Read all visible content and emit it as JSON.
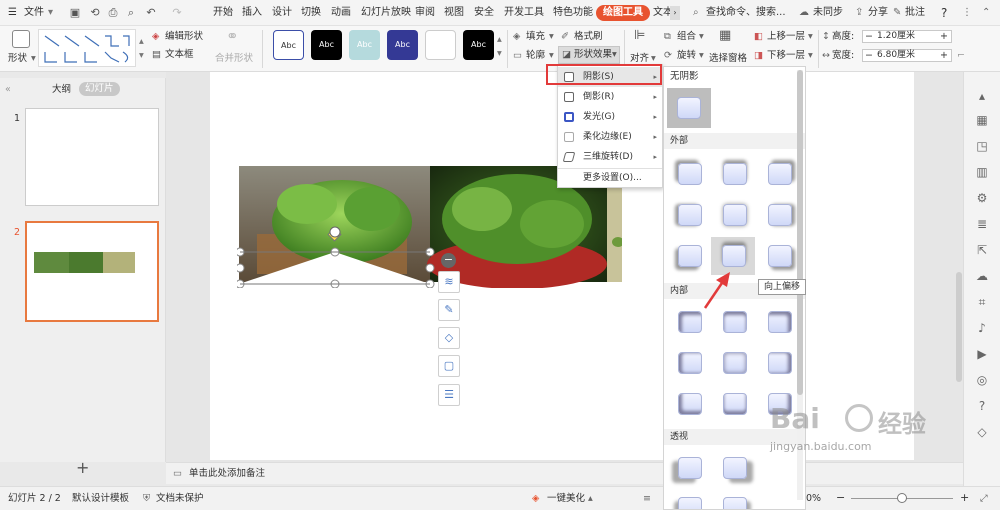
{
  "menubar": {
    "file": "文件",
    "tabs": [
      "开始",
      "插入",
      "设计",
      "切换",
      "动画",
      "幻灯片放映",
      "审阅",
      "视图",
      "安全",
      "开发工具",
      "特色功能",
      "绘图工具",
      "文本"
    ],
    "search": "查找命令、搜索...",
    "sync": "未同步",
    "share": "分享",
    "comment": "批注",
    "help": "?"
  },
  "ribbon": {
    "shape": "形状",
    "edit_shape": "编辑形状",
    "textbox": "文本框",
    "merge_shape": "合并形状",
    "style_label": "Abc",
    "fill": "填充",
    "format_painter": "格式刷",
    "outline": "轮廓",
    "shape_effect": "形状效果",
    "align": "对齐",
    "group": "组合",
    "rotate": "旋转",
    "selection_pane": "选择窗格",
    "bring_forward": "上移一层",
    "send_backward": "下移一层",
    "height_label": "高度:",
    "height_value": "1.20厘米",
    "width_label": "宽度:",
    "width_value": "6.80厘米"
  },
  "slidepanel": {
    "tab_outline": "大纲",
    "tab_slides": "幻灯片",
    "num1": "1",
    "num2": "2",
    "add": "+"
  },
  "notes": {
    "placeholder": "单击此处添加备注"
  },
  "menu": {
    "items": [
      "阴影(S)",
      "倒影(R)",
      "发光(G)",
      "柔化边缘(E)",
      "三维旋转(D)",
      "更多设置(O)..."
    ]
  },
  "gallery": {
    "no_shadow": "无阴影",
    "outer": "外部",
    "inner": "内部",
    "perspective": "透视"
  },
  "tooltip": "向上偏移",
  "status": {
    "slide": "幻灯片 2 / 2",
    "template": "默认设计模板",
    "protect": "文档未保护",
    "beautify": "一键美化",
    "zoom": "0%"
  },
  "watermark": {
    "brand": "Bai",
    "brand2": "经验",
    "url": "jingyan.baidu.com"
  },
  "colors": {
    "accent": "#e8532f",
    "highlight": "#e23a3a",
    "tab_active": "#e8532f"
  }
}
